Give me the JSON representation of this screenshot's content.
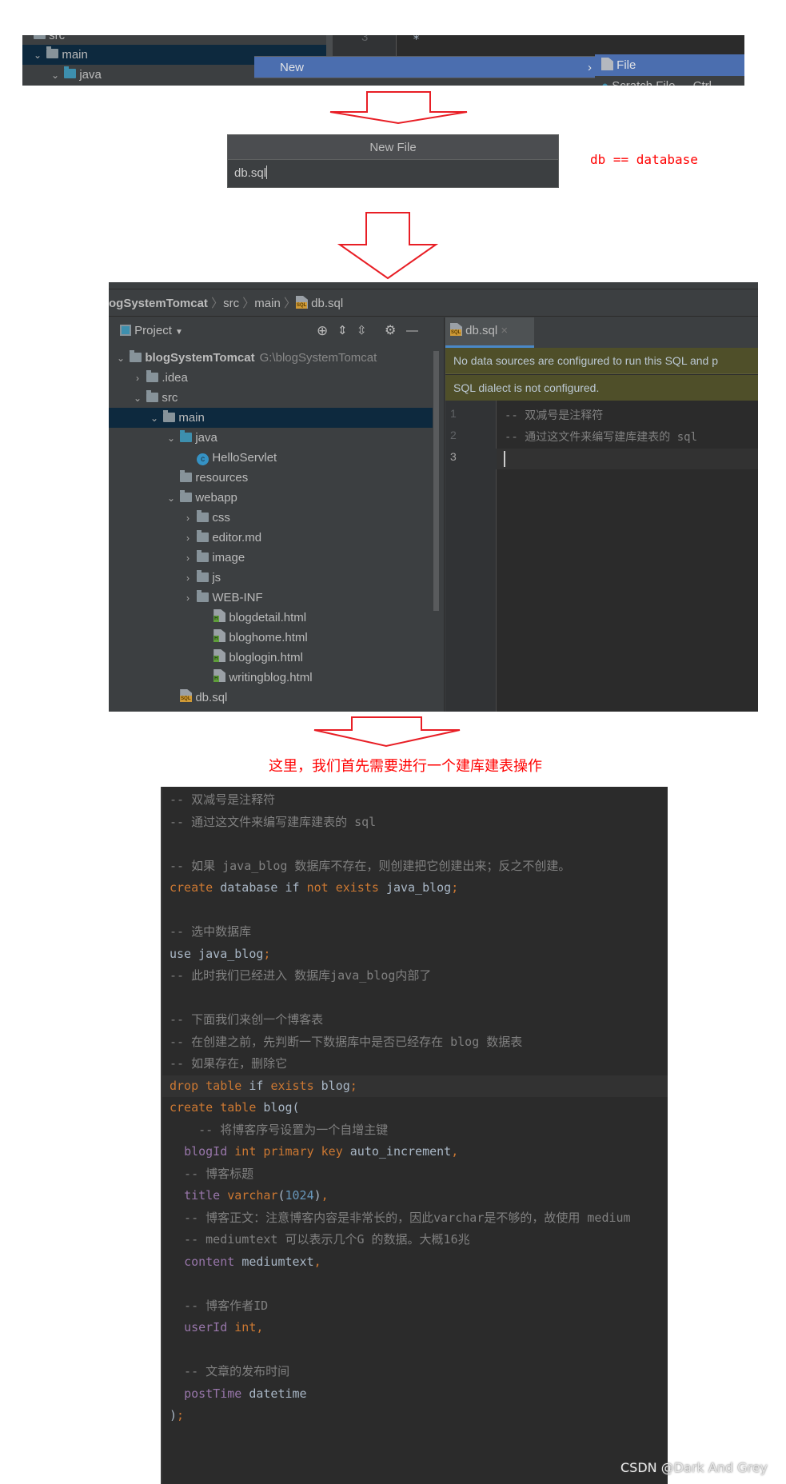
{
  "step1": {
    "tree_items": [
      {
        "label": "src",
        "arrow": "",
        "icon": "folder"
      },
      {
        "label": "main",
        "arrow": "expanded",
        "icon": "folder",
        "selected": true
      },
      {
        "label": "java",
        "arrow": "expanded",
        "icon": "folder-blue"
      }
    ],
    "gutter_line": "3",
    "editor_text": "*",
    "menu_item": "New",
    "submenu": [
      {
        "label": "File",
        "icon": "file-icon"
      },
      {
        "label": "Scratch File",
        "shortcut": "Ctrl"
      }
    ]
  },
  "dialog": {
    "title": "New File",
    "value": "db.sql"
  },
  "note_db": "db == database",
  "ide": {
    "breadcrumb": [
      "ogSystemTomcat",
      "src",
      "main",
      "db.sql"
    ],
    "project_label": "Project",
    "tree": [
      {
        "label": "blogSystemTomcat",
        "path": "G:\\blogSystemTomcat",
        "depth": 0,
        "arrow": "expanded",
        "icon": "module"
      },
      {
        "label": ".idea",
        "depth": 1,
        "arrow": "collapsed",
        "icon": "folder"
      },
      {
        "label": "src",
        "depth": 1,
        "arrow": "expanded",
        "icon": "folder"
      },
      {
        "label": "main",
        "depth": 2,
        "arrow": "expanded",
        "icon": "folder",
        "selected": true
      },
      {
        "label": "java",
        "depth": 3,
        "arrow": "expanded",
        "icon": "folder-blue"
      },
      {
        "label": "HelloServlet",
        "depth": 4,
        "arrow": "",
        "icon": "class"
      },
      {
        "label": "resources",
        "depth": 3,
        "arrow": "",
        "icon": "folder-resources"
      },
      {
        "label": "webapp",
        "depth": 3,
        "arrow": "expanded",
        "icon": "folder"
      },
      {
        "label": "css",
        "depth": 4,
        "arrow": "collapsed",
        "icon": "folder"
      },
      {
        "label": "editor.md",
        "depth": 4,
        "arrow": "collapsed",
        "icon": "folder"
      },
      {
        "label": "image",
        "depth": 4,
        "arrow": "collapsed",
        "icon": "folder"
      },
      {
        "label": "js",
        "depth": 4,
        "arrow": "collapsed",
        "icon": "folder"
      },
      {
        "label": "WEB-INF",
        "depth": 4,
        "arrow": "collapsed",
        "icon": "folder"
      },
      {
        "label": "blogdetail.html",
        "depth": 5,
        "arrow": "",
        "icon": "html"
      },
      {
        "label": "bloghome.html",
        "depth": 5,
        "arrow": "",
        "icon": "html"
      },
      {
        "label": "bloglogin.html",
        "depth": 5,
        "arrow": "",
        "icon": "html"
      },
      {
        "label": "writingblog.html",
        "depth": 5,
        "arrow": "",
        "icon": "html"
      },
      {
        "label": "db.sql",
        "depth": 3,
        "arrow": "",
        "icon": "sql"
      }
    ],
    "tab": "db.sql",
    "banner1": "No data sources are configured to run this SQL and p",
    "banner2": "SQL dialect is not configured.",
    "line_numbers": [
      "1",
      "2",
      "3"
    ],
    "lines": [
      "-- 双减号是注释符",
      "-- 通过这文件来编写建库建表的 sql",
      ""
    ]
  },
  "note_main": "这里，我们首先需要进行一个建库建表操作",
  "code": [
    [
      [
        "-- 双减号是注释符",
        "cm"
      ]
    ],
    [
      [
        "-- 通过这文件来编写建库建表的 sql",
        "cm"
      ]
    ],
    [],
    [
      [
        "-- 如果 java_blog 数据库不存在，则创建把它创建出来；反之不创建。",
        "cm"
      ]
    ],
    [
      [
        "create ",
        "kw"
      ],
      [
        "database ",
        "id"
      ],
      [
        "if ",
        "id"
      ],
      [
        "not ",
        "kw"
      ],
      [
        "exists ",
        "kw"
      ],
      [
        "java_blog",
        "id"
      ],
      [
        ";",
        "kw"
      ]
    ],
    [],
    [
      [
        "-- 选中数据库",
        "cm"
      ]
    ],
    [
      [
        "use java_blog",
        "id"
      ],
      [
        ";",
        "kw"
      ]
    ],
    [
      [
        "-- 此时我们已经进入 数据库java_blog内部了",
        "cm"
      ]
    ],
    [],
    [
      [
        "-- 下面我们来创一个博客表",
        "cm"
      ]
    ],
    [
      [
        "-- 在创建之前，先判断一下数据库中是否已经存在 blog 数据表",
        "cm"
      ]
    ],
    [
      [
        "-- 如果存在，删除它",
        "cm"
      ]
    ],
    [
      [
        "drop ",
        "kw"
      ],
      [
        "table ",
        "kw"
      ],
      [
        "if ",
        "id"
      ],
      [
        "exists ",
        "kw"
      ],
      [
        "blog",
        "id"
      ],
      [
        ";",
        "kw"
      ]
    ],
    [
      [
        "create ",
        "kw"
      ],
      [
        "table ",
        "kw"
      ],
      [
        "blog(",
        "id"
      ]
    ],
    [
      [
        "    -- 将博客序号设置为一个自增主键",
        "cm"
      ]
    ],
    [
      [
        "  ",
        "id"
      ],
      [
        "blogId ",
        "col"
      ],
      [
        "int ",
        "kw"
      ],
      [
        "primary ",
        "kw"
      ],
      [
        "key ",
        "kw"
      ],
      [
        "auto_increment",
        "id"
      ],
      [
        ",",
        "kw"
      ]
    ],
    [
      [
        "  -- 博客标题",
        "cm"
      ]
    ],
    [
      [
        "  ",
        "id"
      ],
      [
        "title ",
        "col"
      ],
      [
        "varchar",
        "kw"
      ],
      [
        "(",
        "id"
      ],
      [
        "1024",
        "num"
      ],
      [
        ")",
        "id"
      ],
      [
        ",",
        "kw"
      ]
    ],
    [
      [
        "  -- 博客正文：注意博客内容是非常长的，因此varchar是不够的，故使用 medium",
        "cm"
      ]
    ],
    [
      [
        "  -- mediumtext 可以表示几个G 的数据。大概16兆",
        "cm"
      ]
    ],
    [
      [
        "  ",
        "id"
      ],
      [
        "content ",
        "col"
      ],
      [
        "mediumtext",
        "id"
      ],
      [
        ",",
        "kw"
      ]
    ],
    [],
    [
      [
        "  -- 博客作者ID",
        "cm"
      ]
    ],
    [
      [
        "  ",
        "id"
      ],
      [
        "userId ",
        "col"
      ],
      [
        "int",
        "kw"
      ],
      [
        ",",
        "kw"
      ]
    ],
    [],
    [
      [
        "  -- 文章的发布时间",
        "cm"
      ]
    ],
    [
      [
        "  ",
        "id"
      ],
      [
        "postTime ",
        "col"
      ],
      [
        "datetime",
        "id"
      ]
    ],
    [
      [
        ")",
        "id"
      ],
      [
        ";",
        "kw"
      ]
    ]
  ],
  "highlight_line": 13,
  "watermark": "CSDN @Dark And Grey",
  "colors": {
    "annotation": "#ff0000",
    "keyword": "#cc7832",
    "comment": "#808080",
    "column": "#9876aa",
    "selection": "#0d293e",
    "menu": "#4b6eaf"
  }
}
